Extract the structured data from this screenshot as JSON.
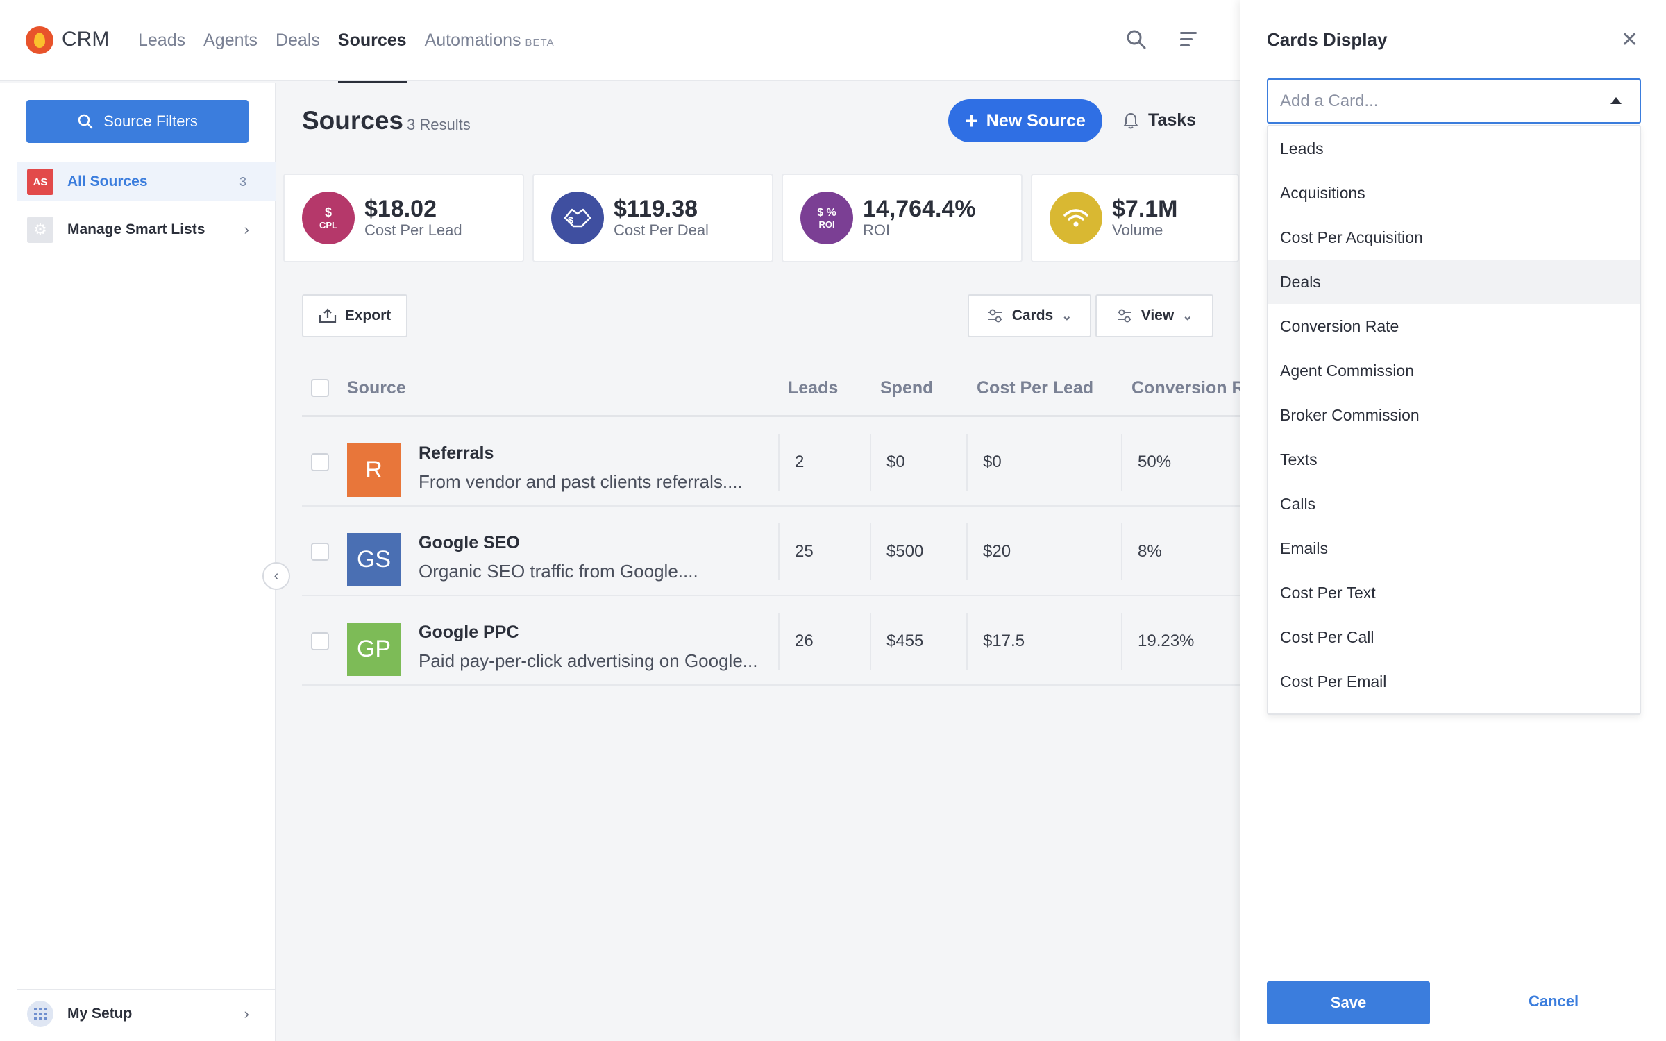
{
  "app": {
    "brand": "CRM"
  },
  "nav": [
    {
      "label": "Leads"
    },
    {
      "label": "Agents"
    },
    {
      "label": "Deals"
    },
    {
      "label": "Sources",
      "active": true
    },
    {
      "label": "Automations",
      "badge": "BETA"
    }
  ],
  "sidebar": {
    "filter_button": "Source Filters",
    "items": [
      {
        "badge": "AS",
        "label": "All Sources",
        "count": "3"
      },
      {
        "label": "Manage Smart Lists"
      }
    ],
    "bottom": "My Setup"
  },
  "page": {
    "title": "Sources",
    "results": "3 Results",
    "new_button": "New Source",
    "tasks_button": "Tasks",
    "export_button": "Export",
    "cards_button": "Cards",
    "view_button": "View"
  },
  "cards": [
    {
      "icon_text": "$",
      "icon_sub": "CPL",
      "value": "$18.02",
      "label": "Cost Per Lead",
      "color": "#b5386a"
    },
    {
      "icon_text": "$",
      "icon_sub": "",
      "value": "$119.38",
      "label": "Cost Per Deal",
      "color": "#3f4fa0"
    },
    {
      "icon_text": "$ %",
      "icon_sub": "ROI",
      "value": "14,764.4%",
      "label": "ROI",
      "color": "#7b3f94"
    },
    {
      "icon_text": "",
      "icon_sub": "",
      "value": "$7.1M",
      "label": "Volume",
      "color": "#d9b832"
    }
  ],
  "table": {
    "headers": [
      "Source",
      "Leads",
      "Spend",
      "Cost Per Lead",
      "Conversion Ra"
    ],
    "rows": [
      {
        "initials": "R",
        "color": "#e8763a",
        "name": "Referrals",
        "desc": "From vendor and past clients referrals....",
        "leads": "2",
        "spend": "$0",
        "cpl": "$0",
        "conv": "50%"
      },
      {
        "initials": "GS",
        "color": "#4a6fb3",
        "name": "Google SEO",
        "desc": "Organic SEO traffic from Google....",
        "leads": "25",
        "spend": "$500",
        "cpl": "$20",
        "conv": "8%"
      },
      {
        "initials": "GP",
        "color": "#7dbb57",
        "name": "Google PPC",
        "desc": "Paid pay-per-click advertising on Google...",
        "leads": "26",
        "spend": "$455",
        "cpl": "$17.5",
        "conv": "19.23%"
      }
    ]
  },
  "panel": {
    "title": "Cards Display",
    "combo_placeholder": "Add a Card...",
    "options": [
      "Leads",
      "Acquisitions",
      "Cost Per Acquisition",
      "Deals",
      "Conversion Rate",
      "Agent Commission",
      "Broker Commission",
      "Texts",
      "Calls",
      "Emails",
      "Cost Per Text",
      "Cost Per Call",
      "Cost Per Email"
    ],
    "hovered_option": "Deals",
    "save": "Save",
    "cancel": "Cancel"
  }
}
